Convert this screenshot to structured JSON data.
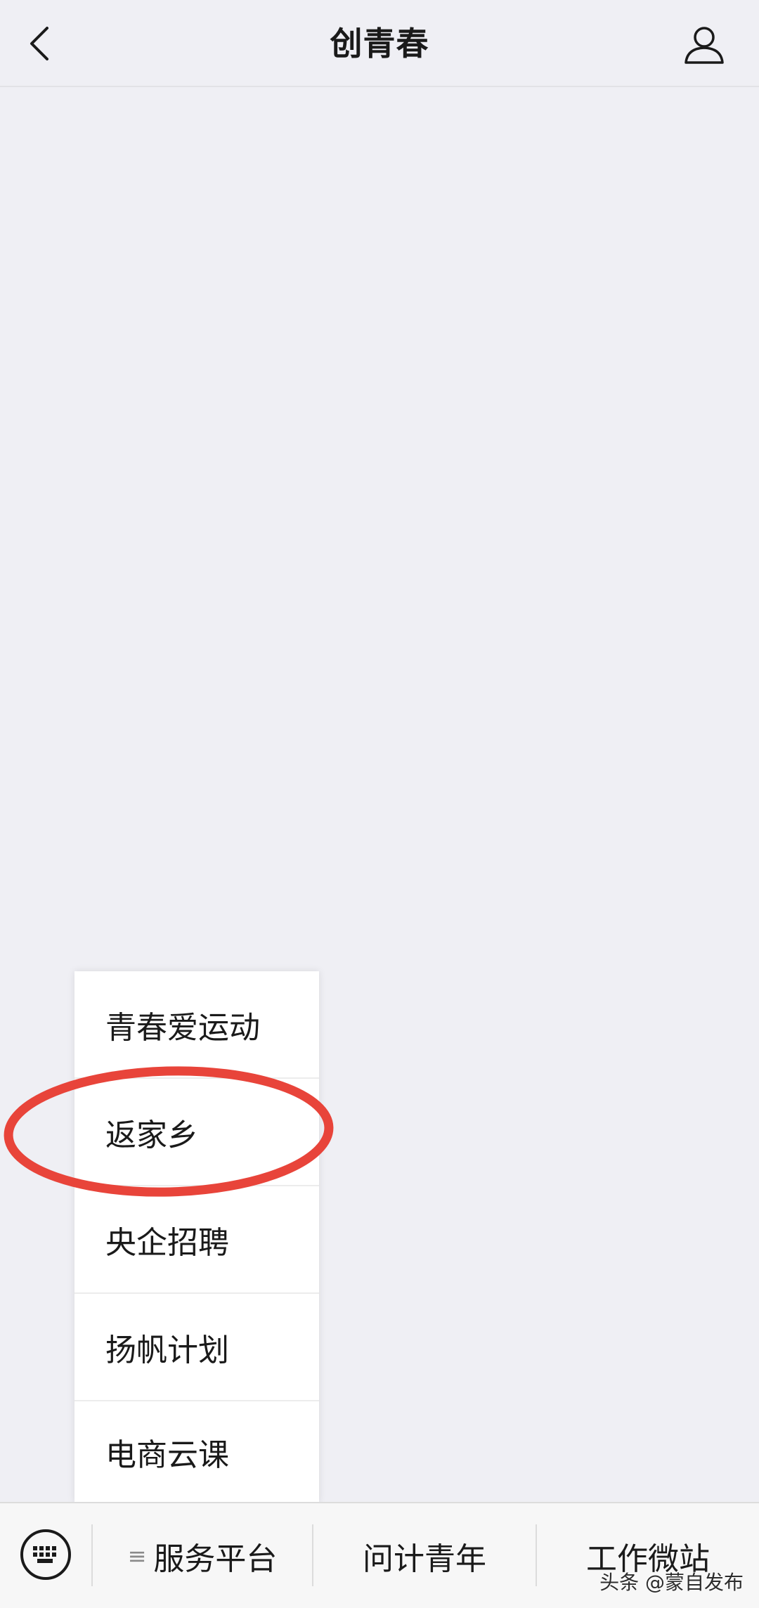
{
  "header": {
    "title": "创青春"
  },
  "popup_menu": {
    "items": [
      {
        "label": "青春爱运动"
      },
      {
        "label": "返家乡"
      },
      {
        "label": "央企招聘"
      },
      {
        "label": "扬帆计划"
      },
      {
        "label": "电商云课"
      }
    ],
    "highlighted_item": "返家乡",
    "highlight_color": "#e8443a"
  },
  "bottom_menu": {
    "tabs": [
      {
        "label": "服务平台",
        "glyph": "≡"
      },
      {
        "label": "问计青年"
      },
      {
        "label": "工作微站"
      }
    ]
  },
  "watermark": {
    "text": "头条 @蒙自发布"
  },
  "icons": {
    "back": "chevron-left-icon",
    "profile": "user-profile-icon",
    "keyboard": "keyboard-icon"
  }
}
